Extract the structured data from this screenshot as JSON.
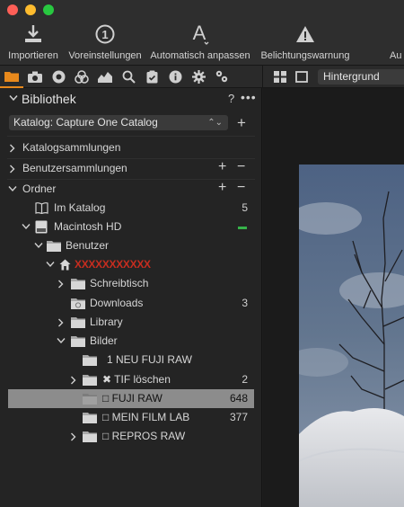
{
  "toolbar": {
    "items": [
      {
        "label": "Importieren",
        "icon": "import-icon"
      },
      {
        "label": "Voreinstellungen",
        "icon": "presets-icon"
      },
      {
        "label": "Automatisch anpassen",
        "icon": "auto-adjust-icon"
      },
      {
        "label": "Belichtungswarnung",
        "icon": "exposure-warning-icon"
      },
      {
        "label": "Au",
        "icon": "auto-icon"
      }
    ]
  },
  "tabs": [
    "folder-icon",
    "camera-icon",
    "lens-icon",
    "color-icon",
    "exposure-icon",
    "details-icon",
    "adjustments-icon",
    "metadata-icon",
    "settings-icon",
    "batch-icon"
  ],
  "viewer": {
    "background_label": "Hintergrund"
  },
  "library": {
    "title": "Bibliothek",
    "help": "?",
    "more": "•••",
    "catalog_select": "Katalog: Capture One Catalog",
    "catalog_add": "+",
    "sections": [
      {
        "label": "Katalogsammlungen"
      },
      {
        "label": "Benutzersammlungen",
        "add": "+",
        "remove": "−"
      },
      {
        "label": "Ordner",
        "add": "+",
        "remove": "−"
      }
    ],
    "tree": [
      {
        "label": "Im Katalog",
        "count": "5"
      },
      {
        "label": "Macintosh HD",
        "count": ""
      },
      {
        "label": "Benutzer",
        "count": ""
      },
      {
        "label": "XXXXXXXXXXX",
        "count": ""
      },
      {
        "label": "Schreibtisch",
        "count": ""
      },
      {
        "label": "Downloads",
        "count": "3"
      },
      {
        "label": "Library",
        "count": ""
      },
      {
        "label": "Bilder",
        "count": ""
      },
      {
        "label": "1 NEU FUJI RAW",
        "count": ""
      },
      {
        "label": "✖ TIF löschen",
        "count": "2"
      },
      {
        "label": "□ FUJI RAW",
        "count": "648"
      },
      {
        "label": "□ MEIN FILM LAB",
        "count": "377"
      },
      {
        "label": "□ REPROS RAW",
        "count": ""
      }
    ]
  },
  "colors": {
    "accent": "#e8891c",
    "status_green": "#36b34a",
    "selected": "#8c8c8c"
  }
}
